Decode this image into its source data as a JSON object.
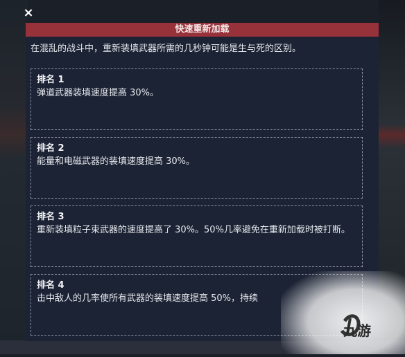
{
  "dialog": {
    "close_icon": "×",
    "title": "快速重新加载",
    "intro": "在混乱的战斗中，重新装填武器所需的几秒钟可能是生与死的区别。",
    "ranks": [
      {
        "title": "排名 1",
        "desc": "弹道武器装填速度提高 30%。"
      },
      {
        "title": "排名 2",
        "desc": "能量和电磁武器的装填速度提高 30%。"
      },
      {
        "title": "排名 3",
        "desc": "重新装填粒子束武器的速度提高了 30%。50%几率避免在重新加载时被打断。"
      },
      {
        "title": "排名 4",
        "desc": "击中敌人的几率使所有武器的装填速度提高 50%，持续"
      }
    ]
  },
  "watermark": {
    "text": "九游"
  },
  "colors": {
    "title_bar": "#97313a",
    "panel_bg": "#1c2334",
    "border": "#8d93a0"
  }
}
